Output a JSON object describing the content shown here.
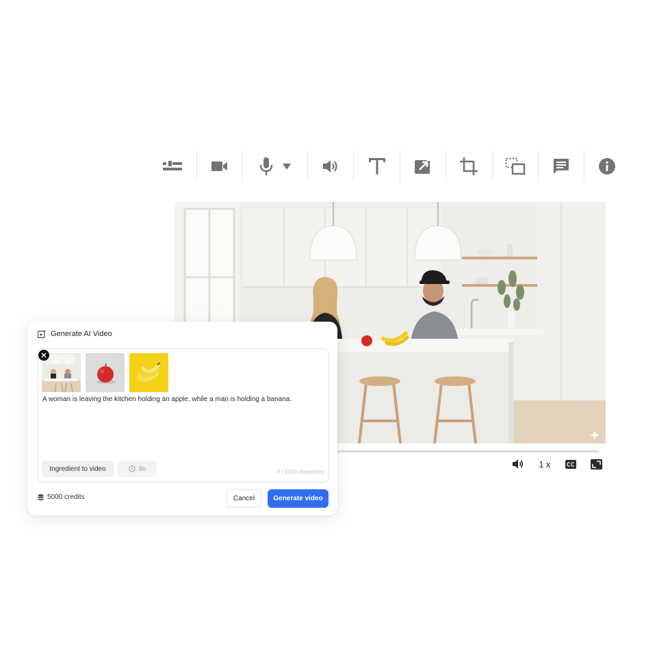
{
  "toolbar": {
    "items": [
      {
        "icon": "timeline-icon"
      },
      {
        "icon": "video-camera-icon"
      },
      {
        "icon": "microphone-icon"
      },
      {
        "icon": "speaker-icon"
      },
      {
        "icon": "text-icon"
      },
      {
        "icon": "export-icon"
      },
      {
        "icon": "crop-icon"
      },
      {
        "icon": "resize-icon"
      },
      {
        "icon": "comment-icon"
      },
      {
        "icon": "info-icon"
      }
    ]
  },
  "player": {
    "speed_label": "1 x",
    "progress": 0,
    "cc_label": "CC"
  },
  "panel": {
    "title": "Generate AI Video",
    "prompt": "A woman is leaving the kitchen holding an apple, while a man is holding a banana.",
    "ingredients": [
      {
        "name": "kitchen-scene-thumbnail"
      },
      {
        "name": "apple-thumbnail"
      },
      {
        "name": "banana-thumbnail"
      }
    ],
    "mode_label": "Ingredient to video",
    "duration_label": "8s",
    "char_count": "0 / 2000 characters",
    "credits_label": "5000 credits",
    "cancel_label": "Cancel",
    "generate_label": "Generate video"
  },
  "colors": {
    "accent": "#2f6ef2",
    "toolbar_icon": "#737373",
    "banana_bg": "#f5d21a"
  }
}
